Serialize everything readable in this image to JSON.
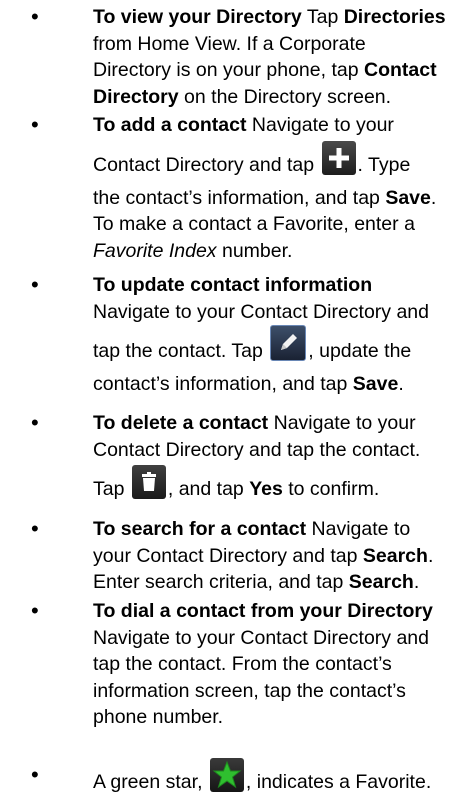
{
  "items": [
    {
      "bold": "To view your Directory",
      "t1": " Tap ",
      "b2": "Directories",
      "t2": " from Home View. If a Corporate Directory is on your phone, tap ",
      "b3": "Contact Directory",
      "t3": " on the Directory screen."
    },
    {
      "bold": "To add a contact",
      "t1": " Navigate to your Contact Directory and tap ",
      "t2": ". Type the contact’s information, and tap ",
      "b2": "Save",
      "t3": ". To make a contact a Favorite, enter a ",
      "i1": "Favorite Index",
      "t4": " number."
    },
    {
      "bold": "To update contact information",
      "t1": " Navigate to your Contact Directory and tap the contact. Tap ",
      "t2": ", update the contact’s information, and tap ",
      "b2": "Save",
      "t3": "."
    },
    {
      "bold": "To delete a contact",
      "t1": " Navigate to your Contact Directory and tap the contact. Tap ",
      "t2": ", and tap ",
      "b2": "Yes",
      "t3": " to confirm."
    },
    {
      "bold": "To search for a contact",
      "t1": " Navigate to your Contact Directory and tap ",
      "b2": "Search",
      "t2": ". Enter search criteria, and tap ",
      "b3": "Search",
      "t3": "."
    },
    {
      "bold": "To dial a contact from your Directory",
      "t1": " Navigate to your Contact Directory and tap the contact. From the contact’s information screen, tap the contact’s phone number."
    },
    {
      "t1": "A green star, ",
      "t2": ", indicates a Favorite."
    }
  ],
  "icons": {
    "add": "plus-icon",
    "edit": "pencil-edit-icon",
    "delete": "trash-icon",
    "favorite": "green-star-icon"
  },
  "colors": {
    "star": "#2fbf2f"
  }
}
